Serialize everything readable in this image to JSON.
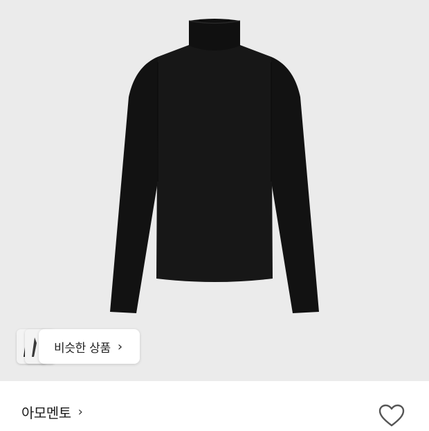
{
  "similar": {
    "label": "비슷한 상품",
    "chevron": "›"
  },
  "brand": {
    "name": "아모멘토",
    "chevron": "›"
  },
  "icons": {
    "favorite": "heart-outline-icon",
    "similar_chevron": "chevron-right-icon",
    "brand_chevron": "chevron-right-icon"
  },
  "colors": {
    "image_background": "#ebebeb",
    "product": "#141414",
    "text": "#1c1c1c"
  }
}
